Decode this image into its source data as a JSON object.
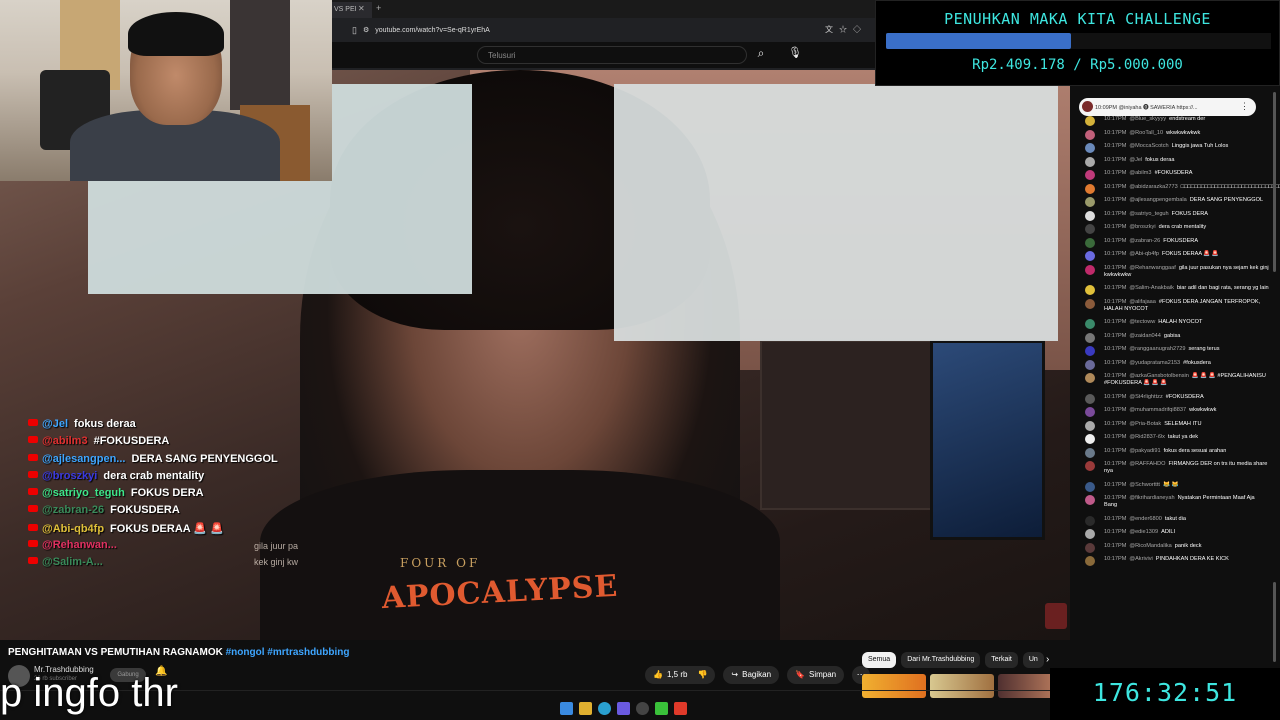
{
  "browser": {
    "tab_label": "VS PEI",
    "url": "youtube.com/watch?v=Se-qR1yrEhA",
    "search_placeholder": "Telusuri"
  },
  "challenge": {
    "title": "PENUHKAN MAKA KITA CHALLENGE",
    "amount": "Rp2.409.178 / Rp5.000.000",
    "progress_fraction": 0.48,
    "color": "#3ee6e0",
    "bar_color": "#3a6fc8"
  },
  "chat_panel": {
    "pinned": "10:09PM @iniyaha ⓿ SAWERIA https://...",
    "messages": [
      {
        "time": "10:17PM",
        "user": "@Blue_skyyyy",
        "text": "endstream der",
        "color": "#d4b23a"
      },
      {
        "time": "10:17PM",
        "user": "@RooTall_10",
        "text": "wkwkwkwkwk",
        "color": "#c2607a"
      },
      {
        "time": "10:17PM",
        "user": "@MoccaScotch",
        "text": "Linggis jawa Tuh Lolos",
        "color": "#6a8abb"
      },
      {
        "time": "10:17PM",
        "user": "@Jel",
        "text": "fokus deraa",
        "color": "#aaa"
      },
      {
        "time": "10:17PM",
        "user": "@abilm3",
        "text": "#FOKUSDERA",
        "color": "#c03a7a"
      },
      {
        "time": "10:17PM",
        "user": "@abidzarazka2773",
        "text": "□□□□□□□□□□□□□□□□□□□□□□□□□□□□□□□□□□□□□□□□□□□□□□□□□□□□□□□□□□□□□□□□□□□□□□□□□□□□",
        "color": "#e07a30"
      },
      {
        "time": "10:17PM",
        "user": "@ajlesangpengembala",
        "text": "DERA SANG PENYENGGOL",
        "color": "#9a9a6a"
      },
      {
        "time": "10:17PM",
        "user": "@satriyo_teguh",
        "text": "FOKUS DERA",
        "color": "#ddd"
      },
      {
        "time": "10:17PM",
        "user": "@broszkyi",
        "text": "dera crab mentality",
        "color": "#444"
      },
      {
        "time": "10:17PM",
        "user": "@zabran-26",
        "text": "FOKUSDERA",
        "color": "#3a6a3a"
      },
      {
        "time": "10:17PM",
        "user": "@Abi-qb4fp",
        "text": "FOKUS DERAA 🚨 🚨",
        "color": "#6a6ae0"
      },
      {
        "time": "10:17PM",
        "user": "@Rehanwanggaaf",
        "text": "gila juur pasukan nya sejam kek ginj kwkwkwkw",
        "color": "#c02a6a"
      },
      {
        "time": "10:17PM",
        "user": "@Salim-Anakbaik",
        "text": "biar adil dan bagi rata, serang yg lain",
        "color": "#e0c03a"
      },
      {
        "time": "10:17PM",
        "user": "@alifajaaa",
        "text": "#FOKUS DERA JANGAN TERFROPOK, HALAH NYOCOT",
        "color": "#8a5a3a"
      },
      {
        "time": "10:17PM",
        "user": "@tectoww",
        "text": "HALAH NYOCOT",
        "color": "#3a8a6a"
      },
      {
        "time": "10:17PM",
        "user": "@zaidan044",
        "text": "gabisa",
        "color": "#777"
      },
      {
        "time": "10:17PM",
        "user": "@ranggaanugrah2729",
        "text": "serang terus",
        "color": "#3a3ac0"
      },
      {
        "time": "10:17PM",
        "user": "@yudapratama2153",
        "text": "#fokusdera",
        "color": "#6a6a9a"
      },
      {
        "time": "10:17PM",
        "user": "@azkaGansbotolbensin",
        "text": "🚨 🚨 🚨 #PENGALIHANISU #FOKUSDERA 🚨 🚨 🚨",
        "color": "#b08a5a"
      },
      {
        "time": "10:17PM",
        "user": "@St4rlighttzz",
        "text": "#FOKUSDERA",
        "color": "#5a5a5a"
      },
      {
        "time": "10:17PM",
        "user": "@muhammadrifqi8837",
        "text": "wkwkwkwk",
        "color": "#7a4a9a"
      },
      {
        "time": "10:17PM",
        "user": "@Pria-Botak",
        "text": "SELEMAH ITU",
        "color": "#aaa"
      },
      {
        "time": "10:17PM",
        "user": "@Rid2837-i9x",
        "text": "takut ya dek",
        "color": "#eee"
      },
      {
        "time": "10:17PM",
        "user": "@pakyadi91",
        "text": "fokus dera sesuai arahan",
        "color": "#6a7a8a"
      },
      {
        "time": "10:17PM",
        "user": "@RAFFAHDO",
        "text": "FIRMANGG DER on trs itu media share nya",
        "color": "#9a3a3a"
      },
      {
        "time": "10:17PM",
        "user": "@Schwortttt",
        "text": "😹 😹",
        "color": "#3a5a8a"
      },
      {
        "time": "10:17PM",
        "user": "@fikrihardianeyah",
        "text": "Nyatakan Permintaan Maaf Aja Bang",
        "color": "#c05a8a"
      },
      {
        "time": "10:17PM",
        "user": "@ender6800",
        "text": "takut dia",
        "color": "#2a2a2a"
      },
      {
        "time": "10:17PM",
        "user": "@edie1309",
        "text": "ADILI",
        "color": "#aaa"
      },
      {
        "time": "10:17PM",
        "user": "@RicoMandalika",
        "text": "panik deck",
        "color": "#5a3a3a"
      },
      {
        "time": "10:17PM",
        "user": "@Akrivivi",
        "text": "PINDAHKAN DERA KE KICK",
        "color": "#8a6a3a"
      }
    ]
  },
  "overlay_chat": [
    {
      "user": "@Jel",
      "text": "fokus deraa",
      "color": "#3ea6ff"
    },
    {
      "user": "@abilm3",
      "text": "#FOKUSDERA",
      "color": "#e03030"
    },
    {
      "user": "@ajlesangpen...",
      "text": "DERA SANG PENYENGGOL",
      "color": "#3ea6ff"
    },
    {
      "user": "@broszkyi",
      "text": "dera crab mentality",
      "color": "#3a3ae0"
    },
    {
      "user": "@satriyo_teguh",
      "text": "FOKUS DERA",
      "color": "#3ee68a"
    },
    {
      "user": "@zabran-26",
      "text": "FOKUSDERA",
      "color": "#3a8a5a"
    },
    {
      "user": "@Abi-qb4fp",
      "text": "FOKUS DERAA 🚨 🚨",
      "color": "#e0c03a"
    },
    {
      "user": "@Rehanwan...",
      "text": "",
      "color": "#e03060"
    },
    {
      "user": "@Salim-A...",
      "text": "",
      "color": "#3a8a5a"
    }
  ],
  "ghost_text": [
    "gila juur pa",
    "kek ginj kw"
  ],
  "shirt": {
    "top": "FOUR OF",
    "main": "APOCALYPSE"
  },
  "video": {
    "title": "PENGHITAMAN VS PEMUTIHAN RAGNAMOK",
    "tags": "#nongol #mrtrashdubbing",
    "channel": "Mr.Trashdubbing",
    "subs": "26 rb subscriber",
    "join": "Gabung",
    "likes": "1,5 rb",
    "share": "Bagikan",
    "save": "Simpan"
  },
  "chips": [
    "Semua",
    "Dari Mr.Trashdubbing",
    "Terkait",
    "Un"
  ],
  "overlay_text": "p ingfo thr",
  "timer": "176:32:51"
}
